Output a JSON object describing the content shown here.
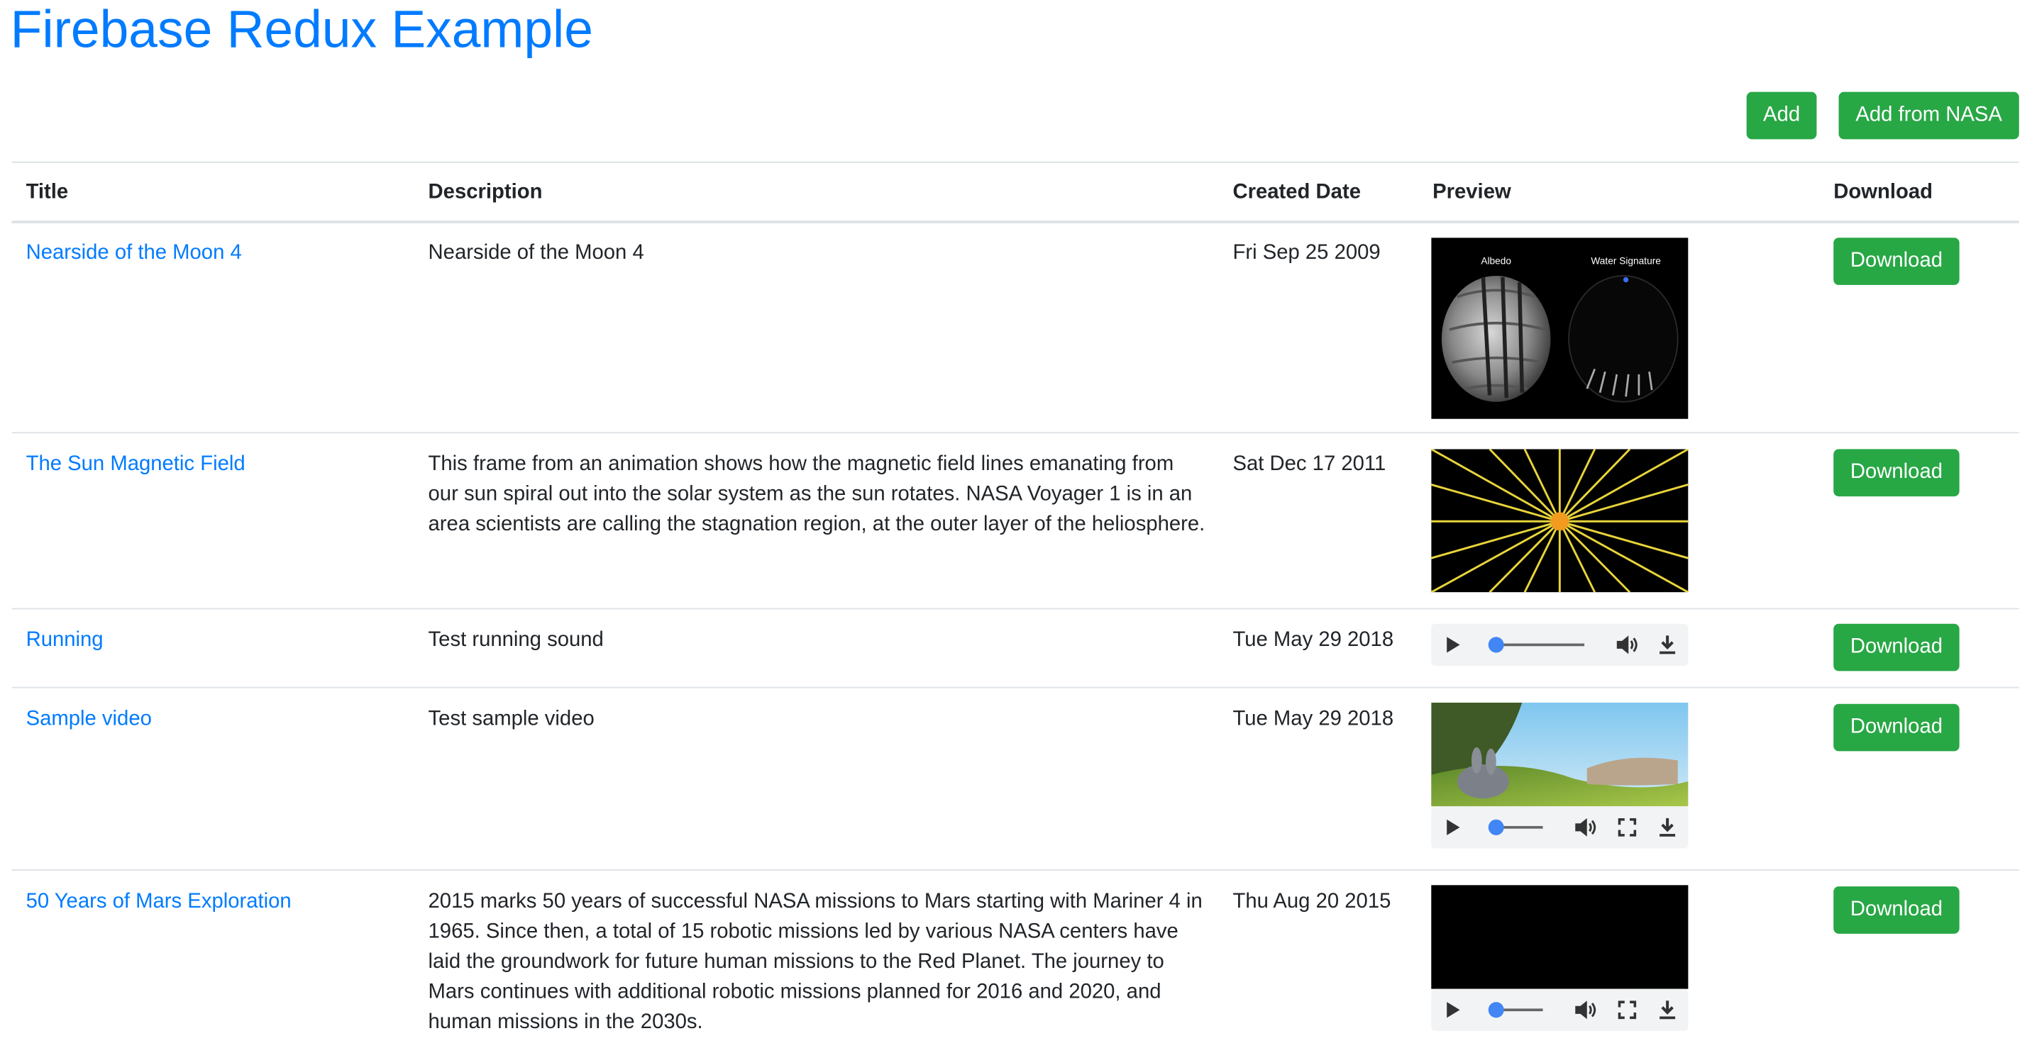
{
  "page": {
    "title": "Firebase Redux Example"
  },
  "toolbar": {
    "add_label": "Add",
    "add_nasa_label": "Add from NASA"
  },
  "table": {
    "headers": [
      "Title",
      "Description",
      "Created Date",
      "Preview",
      "Download"
    ],
    "rows": [
      {
        "title": "Nearside of the Moon 4",
        "description": "Nearside of the Moon 4",
        "date": "Fri Sep 25 2009",
        "preview": "image",
        "labels": [
          "Albedo",
          "Water Signature"
        ],
        "download": "Download"
      },
      {
        "title": "The Sun Magnetic Field",
        "description": "This frame from an animation shows how the magnetic field lines emanating from our sun spiral out into the solar system as the sun rotates. NASA Voyager 1 is in an area scientists are calling the stagnation region, at the outer layer of the heliosphere.",
        "date": "Sat Dec 17 2011",
        "preview": "image",
        "download": "Download"
      },
      {
        "title": "Running",
        "description": "Test running sound",
        "date": "Tue May 29 2018",
        "preview": "audio",
        "download": "Download"
      },
      {
        "title": "Sample video",
        "description": "Test sample video",
        "date": "Tue May 29 2018",
        "preview": "video",
        "download": "Download"
      },
      {
        "title": "50 Years of Mars Exploration",
        "description": "2015 marks 50 years of successful NASA missions to Mars starting with Mariner 4 in 1965. Since then, a total of 15 robotic missions led by various NASA centers have laid the groundwork for future human missions to the Red Planet. The journey to Mars continues with additional robotic missions planned for 2016 and 2020, and human missions in the 2030s.",
        "date": "Thu Aug 20 2015",
        "preview": "video",
        "download": "Download"
      }
    ]
  },
  "colors": {
    "link": "#007bff",
    "success": "#28a745",
    "player_progress": "#4285f4"
  }
}
